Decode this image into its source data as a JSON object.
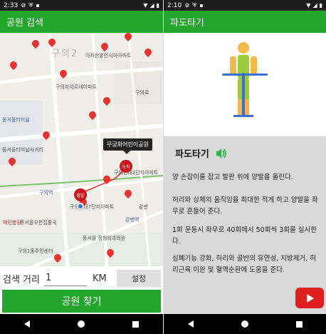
{
  "left": {
    "status": {
      "time": "2:33"
    },
    "title": "공원 검색",
    "map": {
      "callout": "무궁화어린이공원",
      "start_label": "출발",
      "dest_label": "도착",
      "district": "구의2",
      "labels": [
        "아차산휴먼시아아파트",
        "구의자이르네아파트",
        "동서울터미널",
        "동서울터미널사거리",
        "구의현대2단지아파트",
        "구의역",
        "구의현대7단지아파트",
        "강변역",
        "동서울우편집중국",
        "혜민병원",
        "동서울 정형외과의원",
        "구의로",
        "강변",
        "구의1동주민센터"
      ]
    },
    "search": {
      "label": "검색 거리",
      "value": "1",
      "unit": "KM",
      "settings": "설정"
    },
    "find_button": "공원 찾기"
  },
  "right": {
    "status": {
      "time": "2:10"
    },
    "title": "파도타기",
    "exercise_title": "파도타기",
    "paragraphs": [
      "양 손잡이를 잡고 발판 위에 양발을 올린다.",
      "허리와 상체의 움직임을 최대한 적게 하고 양발을 좌우로 흔들어 준다.",
      "1회 운동시 좌우로 40회에서 50회씩 3회를 실시한다.",
      "심폐기능 강화, 허리와 골반의 유연성, 지방제거, 허리근육 이완 및 혈액순환에 도움을 준다."
    ]
  },
  "colors": {
    "accent": "#22a62c",
    "pin": "#e8322f",
    "youtube": "#e02020"
  }
}
